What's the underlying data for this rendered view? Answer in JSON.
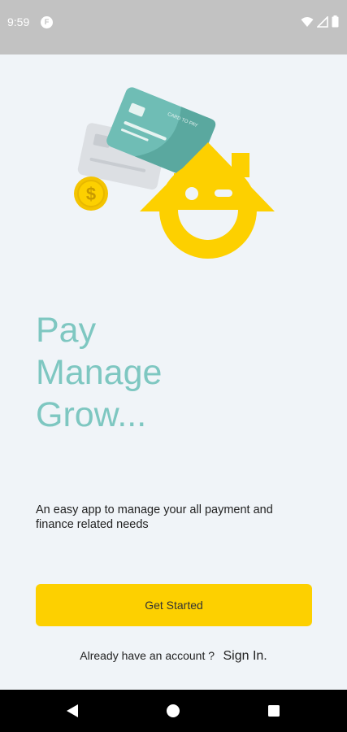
{
  "status_bar": {
    "time": "9:59",
    "app_icon_letter": "F",
    "icons": [
      "wifi-icon",
      "signal-icon",
      "battery-icon"
    ]
  },
  "hero": {
    "illustration": "cards-house-smiley-illustration",
    "card_text": "CARD TO PAY",
    "coin_symbol": "$"
  },
  "headline": {
    "line1": "Pay",
    "line2": "Manage",
    "line3": "Grow..."
  },
  "subtitle": "An easy app to manage your all payment and finance related needs",
  "cta": {
    "label": "Get Started"
  },
  "signin": {
    "prompt": "Already have an account ?",
    "link": "Sign In."
  },
  "nav": {
    "icons": [
      "back-icon",
      "home-icon",
      "recents-icon"
    ]
  },
  "colors": {
    "background": "#f0f4f8",
    "accent_teal": "#7ec7c1",
    "accent_yellow": "#fdd000",
    "status_bar": "#c2c2c2",
    "nav_bar": "#000000"
  }
}
